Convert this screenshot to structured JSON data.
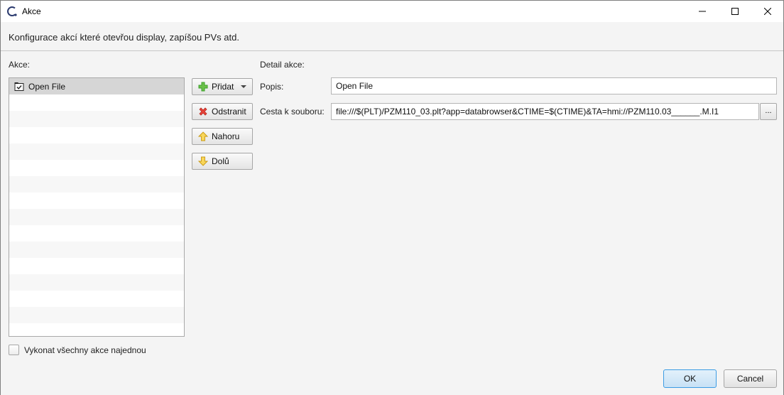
{
  "window": {
    "title": "Akce",
    "controls": {
      "minimize": "minimize-icon",
      "maximize": "maximize-icon",
      "close": "close-icon"
    }
  },
  "header": {
    "description": "Konfigurace akcí které otevřou display, zapíšou PVs atd."
  },
  "actions_panel": {
    "label": "Akce:",
    "items": [
      {
        "label": "Open File",
        "icon": "open-file-icon",
        "selected": true
      }
    ]
  },
  "action_buttons": {
    "add": {
      "label": "Přidat",
      "icon": "plus-icon"
    },
    "remove": {
      "label": "Odstranit",
      "icon": "delete-icon"
    },
    "up": {
      "label": "Nahoru",
      "icon": "arrow-up-icon"
    },
    "down": {
      "label": "Dolů",
      "icon": "arrow-down-icon"
    }
  },
  "detail": {
    "label": "Detail akce:",
    "description_label": "Popis:",
    "description_value": "Open File",
    "path_label": "Cesta k souboru:",
    "path_value": "file:///$(PLT)/PZM110_03.plt?app=databrowser&CTIME=$(CTIME)&TA=hmi://PZM110.03______.M.I1",
    "browse_label": "..."
  },
  "execute_all": {
    "label": "Vykonat všechny akce najednou",
    "checked": false
  },
  "footer": {
    "ok_label": "OK",
    "cancel_label": "Cancel"
  },
  "colors": {
    "accent": "#3c9ce4",
    "selection": "#d6d6d6",
    "add_green": "#3aa02a",
    "remove_red": "#d8312b",
    "arrow_yellow": "#f2c12e"
  }
}
